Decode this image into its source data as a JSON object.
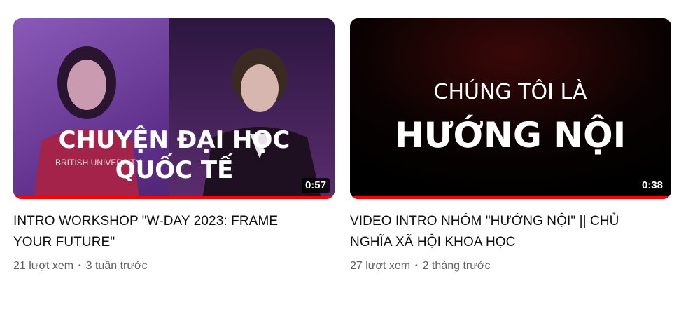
{
  "videos": [
    {
      "thumbnail_line1": "CHUYỆN ĐẠI HỌC",
      "thumbnail_line2": "QUỐC TẾ",
      "thumbnail_shirt_text": "BRITISH UNIVERSITY",
      "duration": "0:57",
      "title": "INTRO WORKSHOP \"W-DAY 2023: FRAME YOUR FUTURE\"",
      "views": "21 lượt xem",
      "age": "3 tuần trước",
      "progress": 1.0
    },
    {
      "thumbnail_line1": "CHÚNG TÔI LÀ",
      "thumbnail_line2": "HƯỚNG NỘI",
      "duration": "0:38",
      "title": "VIDEO INTRO NHÓM \"HƯỚNG NỘI\" || CHỦ NGHĨA XÃ HỘI KHOA HỌC",
      "views": "27 lượt xem",
      "age": "2 tháng trước",
      "progress": 1.0
    }
  ],
  "colors": {
    "progress": "#ff0000",
    "title": "#0f0f0f",
    "meta": "#606060"
  }
}
